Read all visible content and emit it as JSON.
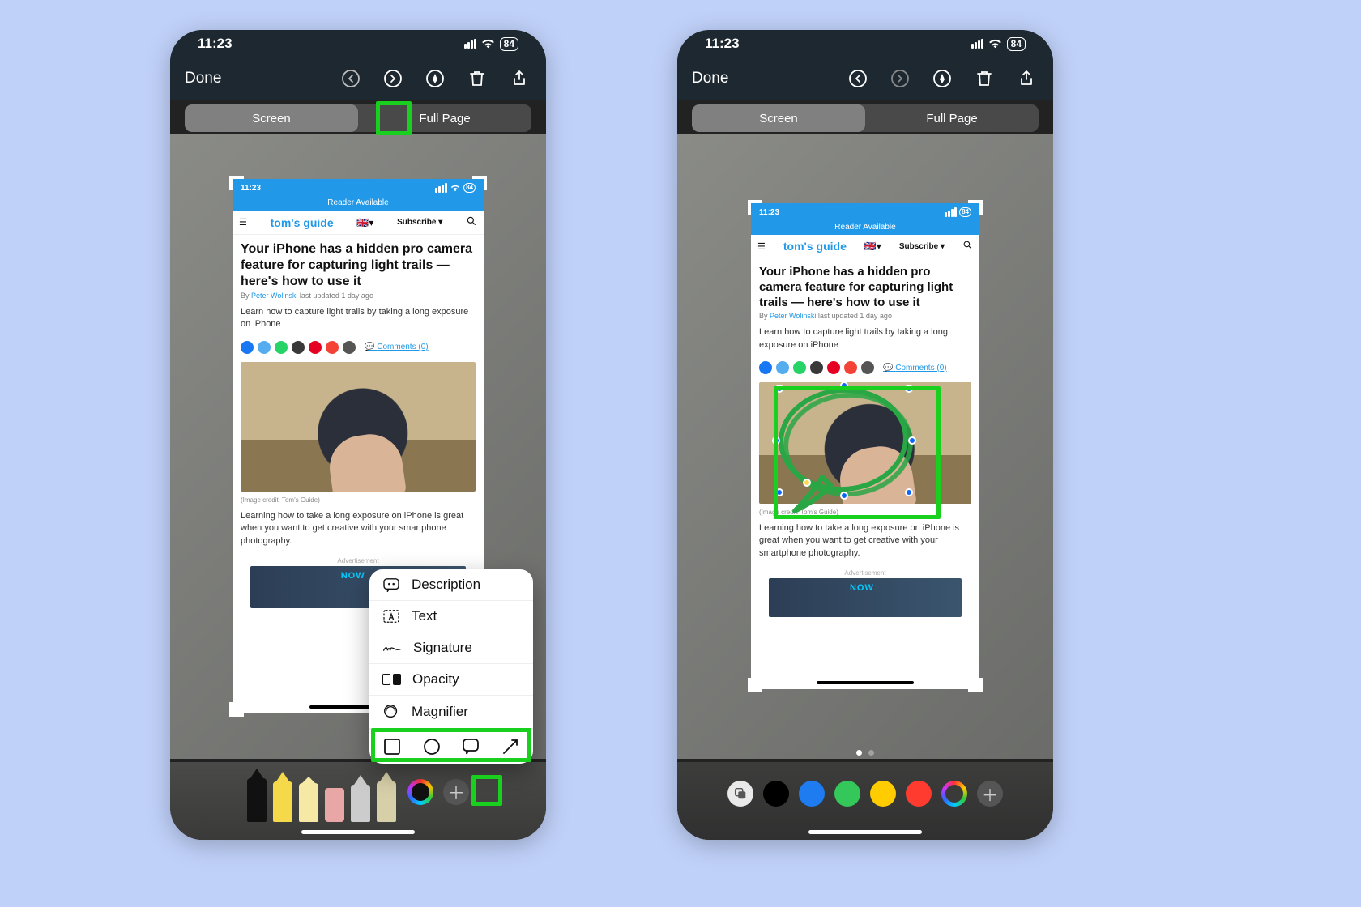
{
  "status": {
    "time": "11:23",
    "battery": "84"
  },
  "mini_status": {
    "time": "11:23",
    "battery": "84"
  },
  "topbar": {
    "done": "Done"
  },
  "seg": {
    "screen": "Screen",
    "fullpage": "Full Page"
  },
  "article": {
    "reader": "Reader Available",
    "logo": "tom's guide",
    "subscribe": "Subscribe ▾",
    "headline": "Your iPhone has a hidden pro camera feature for capturing light trails — here's how to use it",
    "by": "By ",
    "author": "Peter Wolinski",
    "updated": " last updated 1 day ago",
    "deck": "Learn how to capture light trails by taking a long exposure on iPhone",
    "comments": "Comments (0)",
    "credit": "(Image credit: Tom's Guide)",
    "body": "Learning how to take a long exposure on iPhone is great when you want to get creative with your smartphone photography.",
    "ad_label": "Advertisement",
    "ad_brand": "NOW"
  },
  "popup": {
    "description": "Description",
    "text": "Text",
    "signature": "Signature",
    "opacity": "Opacity",
    "magnifier": "Magnifier"
  },
  "thumb": {
    "time": "11:",
    "done": "Done"
  },
  "social_colors": [
    "#1877f2",
    "#55acee",
    "#25d366",
    "#393939",
    "#e60023",
    "#ff6f61",
    "#f44336",
    "#555"
  ]
}
